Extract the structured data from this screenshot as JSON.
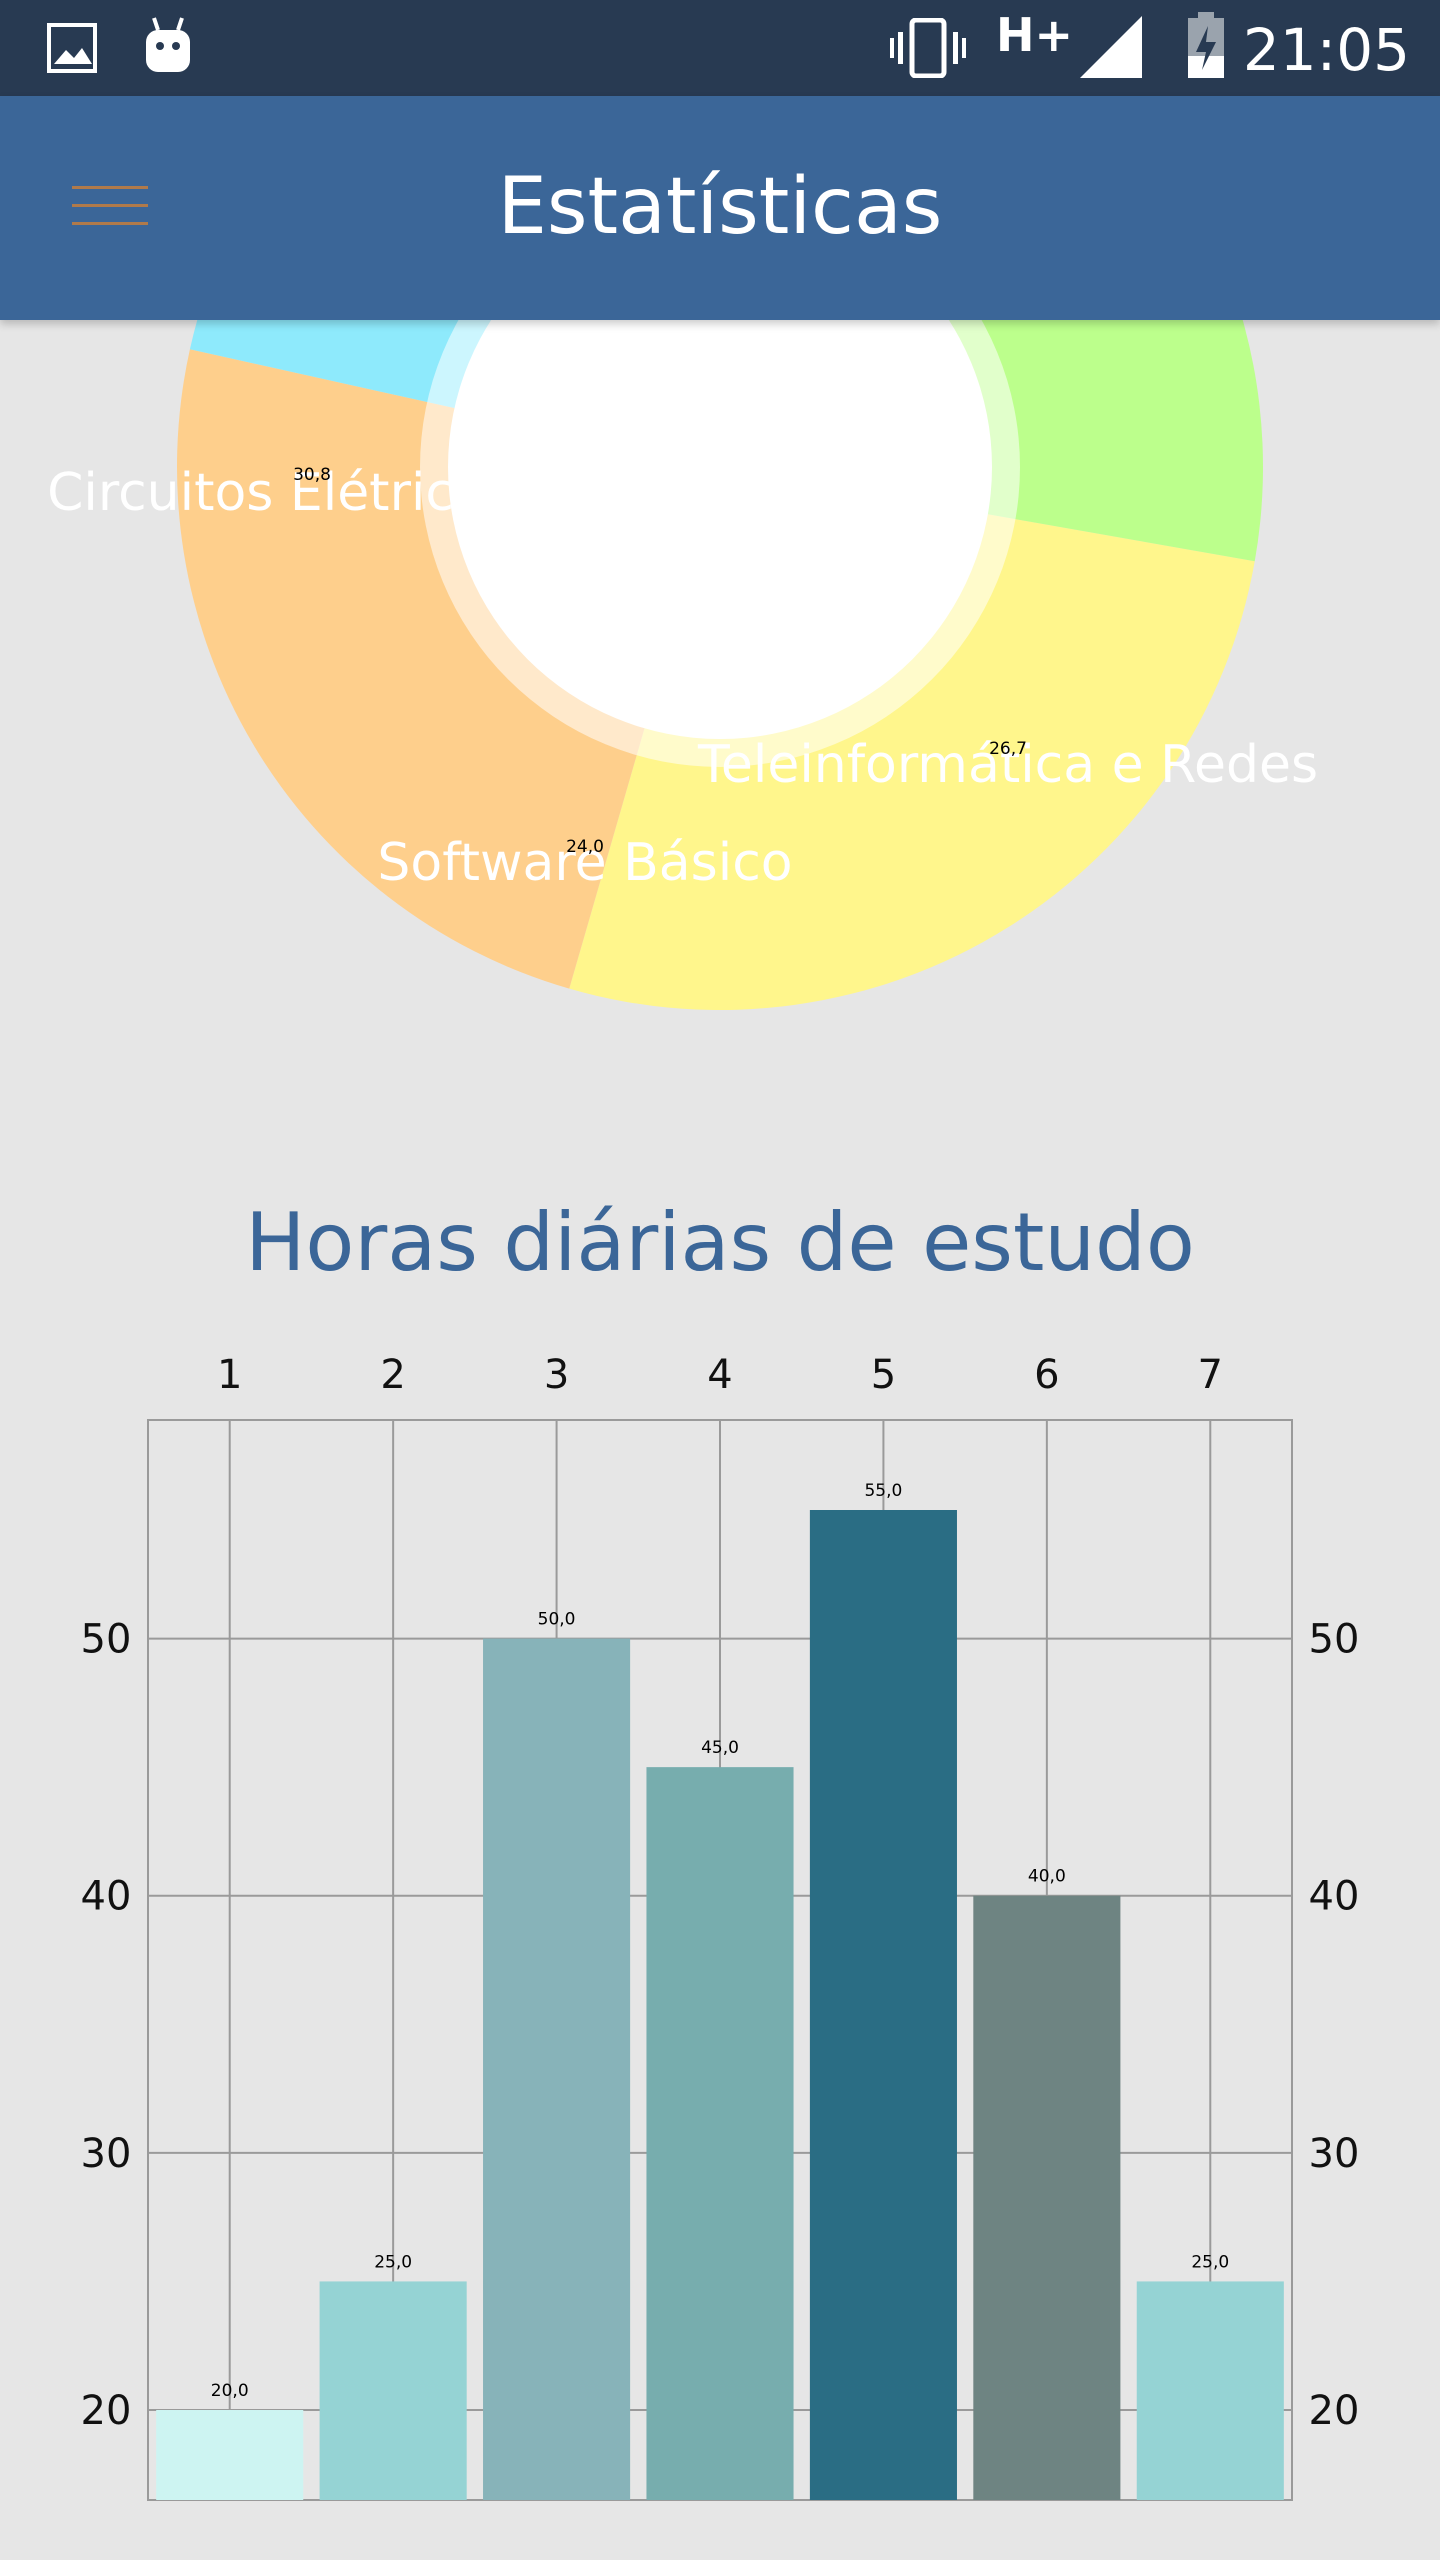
{
  "status_bar": {
    "time": "21:05",
    "network": "H+",
    "icons": [
      "image-icon",
      "android-icon",
      "vibrate-icon",
      "signal-icon",
      "battery-charging-icon"
    ]
  },
  "app_bar": {
    "title": "Estatísticas",
    "menu_icon": "hamburger-menu-icon"
  },
  "donut": {
    "type": "pie",
    "slices": [
      {
        "label": "Circuitos Elétricos",
        "value": 30.8,
        "value_label": "30,8",
        "color": "#8eeafc"
      },
      {
        "label": "Software Básico",
        "value": 24.0,
        "value_label": "24,0",
        "color": "#fecf8c"
      },
      {
        "label": "Teleinformática e Redes",
        "value": 26.7,
        "value_label": "26,7",
        "color": "#fff68c"
      },
      {
        "label": "",
        "value": 18.5,
        "value_label": "",
        "color": "#bcff8c"
      }
    ]
  },
  "bar_section": {
    "title": "Horas diárias de estudo"
  },
  "chart_data": {
    "type": "bar",
    "title": "Horas diárias de estudo",
    "categories": [
      "1",
      "2",
      "3",
      "4",
      "5",
      "6",
      "7"
    ],
    "values": [
      20,
      25,
      50,
      45,
      55,
      40,
      25
    ],
    "value_labels": [
      "20,0",
      "25,0",
      "50,0",
      "45,0",
      "55,0",
      "40,0",
      "25,0"
    ],
    "colors": [
      "#cdf4f2",
      "#95d3d4",
      "#87b3b9",
      "#77adae",
      "#2a6d84",
      "#6e8482",
      "#95d3d4"
    ],
    "y_ticks": [
      "20",
      "30",
      "40",
      "50"
    ],
    "y_min_visible": 16.5,
    "y_max_visible": 58.5,
    "grid": true,
    "x_axis_position": "top",
    "y_axis": "both-sides"
  }
}
